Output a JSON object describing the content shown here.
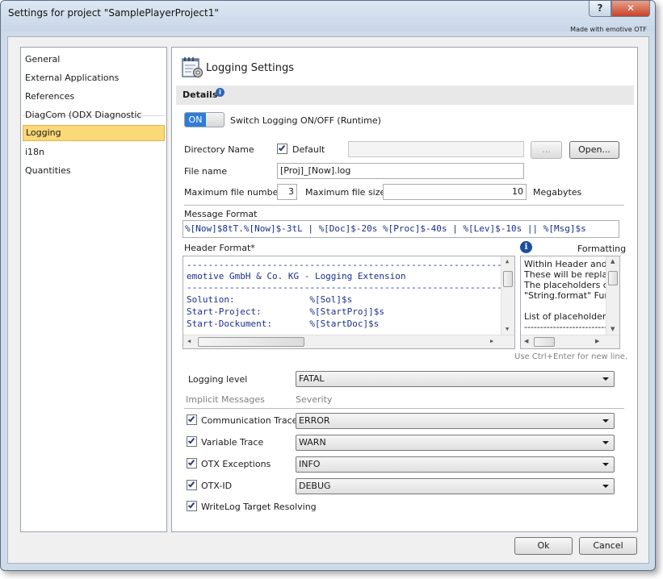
{
  "window": {
    "title": "Settings for project \"SamplePlayerProject1\"",
    "made_with": "Made with emotive OTF",
    "help_glyph": "?",
    "close_glyph": "✕"
  },
  "nav": {
    "items": [
      "General",
      "External Applications",
      "References",
      "DiagCom (ODX Diagnostic Data)",
      "Logging",
      "i18n",
      "Quantities"
    ],
    "selected": "Logging"
  },
  "page": {
    "title": "Logging Settings"
  },
  "details": {
    "label": "Details",
    "info_glyph": "i"
  },
  "switch": {
    "state": "ON",
    "label": "Switch Logging ON/OFF (Runtime)"
  },
  "directory": {
    "label": "Directory Name",
    "default_label": "Default",
    "default_checked": true,
    "value": "",
    "browse_label": "...",
    "open_label": "Open..."
  },
  "file": {
    "label": "File name",
    "value": "[Proj]_[Now].log"
  },
  "limits": {
    "max_number_label": "Maximum file number",
    "max_number_value": "3",
    "max_size_label": "Maximum file size",
    "max_size_value": "10",
    "unit": "Megabytes"
  },
  "message_format": {
    "label": "Message Format",
    "value": "%[Now]$8tT.%[Now]$-3tL | %[Doc]$-20s %[Proc]$-40s | %[Lev]$-10s || %[Msg]$s"
  },
  "header_format": {
    "label": "Header Format*",
    "lines": [
      "-----------------------------------------------------------------",
      "emotive GmbH & Co. KG - Logging Extension",
      "-----------------------------------------------------------------",
      "Solution:              %[Sol]$s",
      "Start-Project:         %[StartProj]$s",
      "Start-Dockument:       %[StartDoc]$s"
    ],
    "hint": "Use Ctrl+Enter for new line."
  },
  "formatting": {
    "info_glyph": "i",
    "label": "Formatting",
    "lines": [
      "Within Header and",
      "These will be replac",
      "The placeholders ca",
      "\"String.format\" Fun",
      "",
      "List of placeholders",
      "--------------------------"
    ]
  },
  "levels": {
    "logging_level_label": "Logging level",
    "logging_level_value": "FATAL",
    "implicit_label": "Implicit Messages",
    "severity_label": "Severity",
    "rows": [
      {
        "label": "Communication Trace",
        "checked": true,
        "value": "ERROR"
      },
      {
        "label": "Variable Trace",
        "checked": true,
        "value": "WARN"
      },
      {
        "label": "OTX Exceptions",
        "checked": true,
        "value": "INFO"
      },
      {
        "label": "OTX-ID",
        "checked": true,
        "value": "DEBUG"
      }
    ],
    "writelog": {
      "label": "WriteLog Target Resolving",
      "checked": true
    }
  },
  "footer": {
    "ok": "Ok",
    "cancel": "Cancel"
  }
}
